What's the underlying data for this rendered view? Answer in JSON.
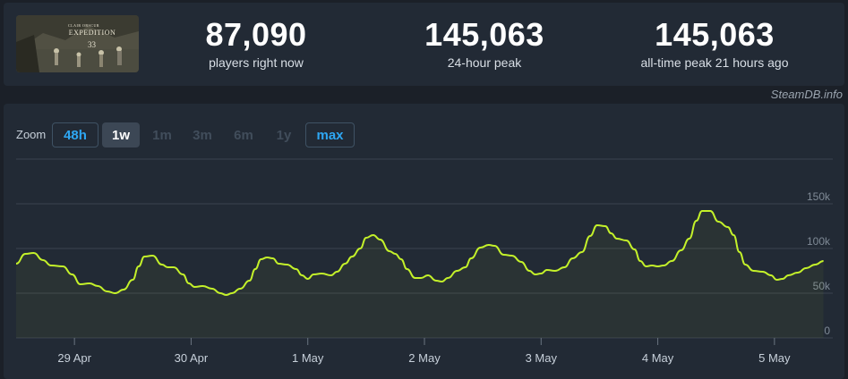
{
  "game": {
    "thumb_title": "EXPEDITION",
    "thumb_sub": "CLAIR OBSCUR",
    "thumb_num": "33"
  },
  "stats": [
    {
      "value": "87,090",
      "label": "players right now"
    },
    {
      "value": "145,063",
      "label": "24-hour peak"
    },
    {
      "value": "145,063",
      "label": "all-time peak 21 hours ago"
    }
  ],
  "credit": "SteamDB.info",
  "zoom": {
    "label": "Zoom",
    "buttons": [
      {
        "label": "48h",
        "state": "active"
      },
      {
        "label": "1w",
        "state": "selected"
      },
      {
        "label": "1m",
        "state": "disabled"
      },
      {
        "label": "3m",
        "state": "disabled"
      },
      {
        "label": "6m",
        "state": "disabled"
      },
      {
        "label": "1y",
        "state": "disabled"
      },
      {
        "label": "max",
        "state": "active"
      }
    ]
  },
  "colors": {
    "line": "#c4f12a",
    "grid": "#3a4350",
    "accent": "#2ea7f3"
  },
  "chart_data": {
    "type": "line",
    "x_tick_labels": [
      "29 Apr",
      "30 Apr",
      "1 May",
      "2 May",
      "3 May",
      "4 May",
      "5 May"
    ],
    "y_tick_labels": [
      "0",
      "50k",
      "100k",
      "150k"
    ],
    "ylim": [
      0,
      150000
    ],
    "x_range_days": [
      -0.5,
      6.5
    ],
    "grid": true,
    "series": [
      {
        "points": [
          [
            -0.5,
            83000
          ],
          [
            -0.42,
            94000
          ],
          [
            -0.35,
            95000
          ],
          [
            -0.27,
            87000
          ],
          [
            -0.2,
            81000
          ],
          [
            -0.1,
            80000
          ],
          [
            -0.02,
            71000
          ],
          [
            0.05,
            60000
          ],
          [
            0.13,
            61000
          ],
          [
            0.2,
            58000
          ],
          [
            0.28,
            52000
          ],
          [
            0.35,
            50000
          ],
          [
            0.42,
            54000
          ],
          [
            0.5,
            65000
          ],
          [
            0.55,
            80000
          ],
          [
            0.6,
            91000
          ],
          [
            0.67,
            92000
          ],
          [
            0.75,
            82000
          ],
          [
            0.8,
            79000
          ],
          [
            0.85,
            79000
          ],
          [
            0.93,
            71000
          ],
          [
            0.98,
            61000
          ],
          [
            1.03,
            57000
          ],
          [
            1.1,
            58000
          ],
          [
            1.18,
            55000
          ],
          [
            1.25,
            50000
          ],
          [
            1.3,
            48000
          ],
          [
            1.35,
            50000
          ],
          [
            1.42,
            55000
          ],
          [
            1.5,
            64000
          ],
          [
            1.55,
            77000
          ],
          [
            1.6,
            88000
          ],
          [
            1.65,
            90000
          ],
          [
            1.7,
            89000
          ],
          [
            1.75,
            83000
          ],
          [
            1.82,
            82000
          ],
          [
            1.9,
            77000
          ],
          [
            1.95,
            70000
          ],
          [
            2.0,
            66000
          ],
          [
            2.05,
            71000
          ],
          [
            2.12,
            72000
          ],
          [
            2.2,
            70000
          ],
          [
            2.25,
            74000
          ],
          [
            2.32,
            83000
          ],
          [
            2.38,
            91000
          ],
          [
            2.45,
            100000
          ],
          [
            2.5,
            112000
          ],
          [
            2.56,
            115000
          ],
          [
            2.62,
            110000
          ],
          [
            2.7,
            97000
          ],
          [
            2.75,
            94000
          ],
          [
            2.8,
            88000
          ],
          [
            2.85,
            77000
          ],
          [
            2.92,
            67000
          ],
          [
            2.97,
            67000
          ],
          [
            3.03,
            70000
          ],
          [
            3.1,
            64000
          ],
          [
            3.15,
            63000
          ],
          [
            3.2,
            67000
          ],
          [
            3.28,
            75000
          ],
          [
            3.35,
            79000
          ],
          [
            3.4,
            89000
          ],
          [
            3.48,
            101000
          ],
          [
            3.55,
            104000
          ],
          [
            3.6,
            103000
          ],
          [
            3.68,
            93000
          ],
          [
            3.75,
            92000
          ],
          [
            3.83,
            85000
          ],
          [
            3.9,
            75000
          ],
          [
            3.95,
            71000
          ],
          [
            4.0,
            72000
          ],
          [
            4.05,
            76000
          ],
          [
            4.12,
            75000
          ],
          [
            4.2,
            79000
          ],
          [
            4.27,
            89000
          ],
          [
            4.35,
            96000
          ],
          [
            4.42,
            114000
          ],
          [
            4.48,
            126000
          ],
          [
            4.55,
            125000
          ],
          [
            4.6,
            117000
          ],
          [
            4.65,
            111000
          ],
          [
            4.73,
            109000
          ],
          [
            4.8,
            99000
          ],
          [
            4.85,
            86000
          ],
          [
            4.9,
            80000
          ],
          [
            4.95,
            81000
          ],
          [
            5.0,
            80000
          ],
          [
            5.05,
            81000
          ],
          [
            5.12,
            86000
          ],
          [
            5.2,
            98000
          ],
          [
            5.27,
            111000
          ],
          [
            5.33,
            131000
          ],
          [
            5.38,
            142000
          ],
          [
            5.45,
            142000
          ],
          [
            5.52,
            130000
          ],
          [
            5.6,
            124000
          ],
          [
            5.65,
            115000
          ],
          [
            5.7,
            96000
          ],
          [
            5.75,
            82000
          ],
          [
            5.82,
            75000
          ],
          [
            5.9,
            74000
          ],
          [
            5.97,
            70000
          ],
          [
            6.02,
            65000
          ],
          [
            6.07,
            66000
          ],
          [
            6.12,
            70000
          ],
          [
            6.2,
            73000
          ],
          [
            6.27,
            78000
          ],
          [
            6.35,
            82000
          ],
          [
            6.42,
            86000
          ]
        ]
      }
    ]
  }
}
